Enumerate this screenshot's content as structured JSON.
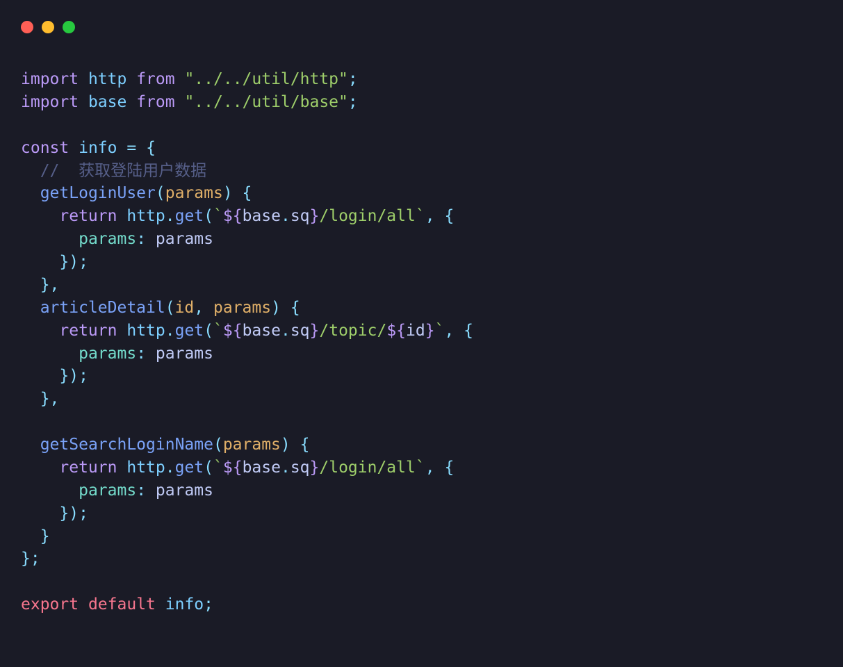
{
  "titlebar": {
    "red": "close",
    "yellow": "minimize",
    "green": "maximize"
  },
  "code": {
    "l1": {
      "t1": "import",
      "t2": "http",
      "t3": "from",
      "t4": "\"../../util/http\"",
      "t5": ";"
    },
    "l2": {
      "t1": "import",
      "t2": "base",
      "t3": "from",
      "t4": "\"../../util/base\"",
      "t5": ";"
    },
    "l4": {
      "t1": "const",
      "t2": "info",
      "t3": "=",
      "t4": "{"
    },
    "l5": {
      "t1": "//  获取登陆用户数据"
    },
    "l6": {
      "t1": "getLoginUser",
      "t2": "(",
      "t3": "params",
      "t4": ")",
      "t5": "{"
    },
    "l7": {
      "t1": "return",
      "t2": "http",
      "t3": ".",
      "t4": "get",
      "t5": "(",
      "t6": "`",
      "t7": "${",
      "t8": "base",
      "t9": ".",
      "t10": "sq",
      "t11": "}",
      "t12": "/login/all",
      "t13": "`",
      "t14": ",",
      "t15": "{"
    },
    "l8": {
      "t1": "params",
      "t2": ":",
      "t3": "params"
    },
    "l9": {
      "t1": "});"
    },
    "l10": {
      "t1": "},"
    },
    "l11": {
      "t1": "articleDetail",
      "t2": "(",
      "t3": "id",
      "t4": ",",
      "t5": "params",
      "t6": ")",
      "t7": "{"
    },
    "l12": {
      "t1": "return",
      "t2": "http",
      "t3": ".",
      "t4": "get",
      "t5": "(",
      "t6": "`",
      "t7": "${",
      "t8": "base",
      "t9": ".",
      "t10": "sq",
      "t11": "}",
      "t12": "/topic/",
      "t13": "${",
      "t14": "id",
      "t15": "}",
      "t16": "`",
      "t17": ",",
      "t18": "{"
    },
    "l13": {
      "t1": "params",
      "t2": ":",
      "t3": "params"
    },
    "l14": {
      "t1": "});"
    },
    "l15": {
      "t1": "},"
    },
    "l17": {
      "t1": "getSearchLoginName",
      "t2": "(",
      "t3": "params",
      "t4": ")",
      "t5": "{"
    },
    "l18": {
      "t1": "return",
      "t2": "http",
      "t3": ".",
      "t4": "get",
      "t5": "(",
      "t6": "`",
      "t7": "${",
      "t8": "base",
      "t9": ".",
      "t10": "sq",
      "t11": "}",
      "t12": "/login/all",
      "t13": "`",
      "t14": ",",
      "t15": "{"
    },
    "l19": {
      "t1": "params",
      "t2": ":",
      "t3": "params"
    },
    "l20": {
      "t1": "});"
    },
    "l21": {
      "t1": "}"
    },
    "l22": {
      "t1": "};"
    },
    "l24": {
      "t1": "export",
      "t2": "default",
      "t3": "info",
      "t4": ";"
    }
  }
}
